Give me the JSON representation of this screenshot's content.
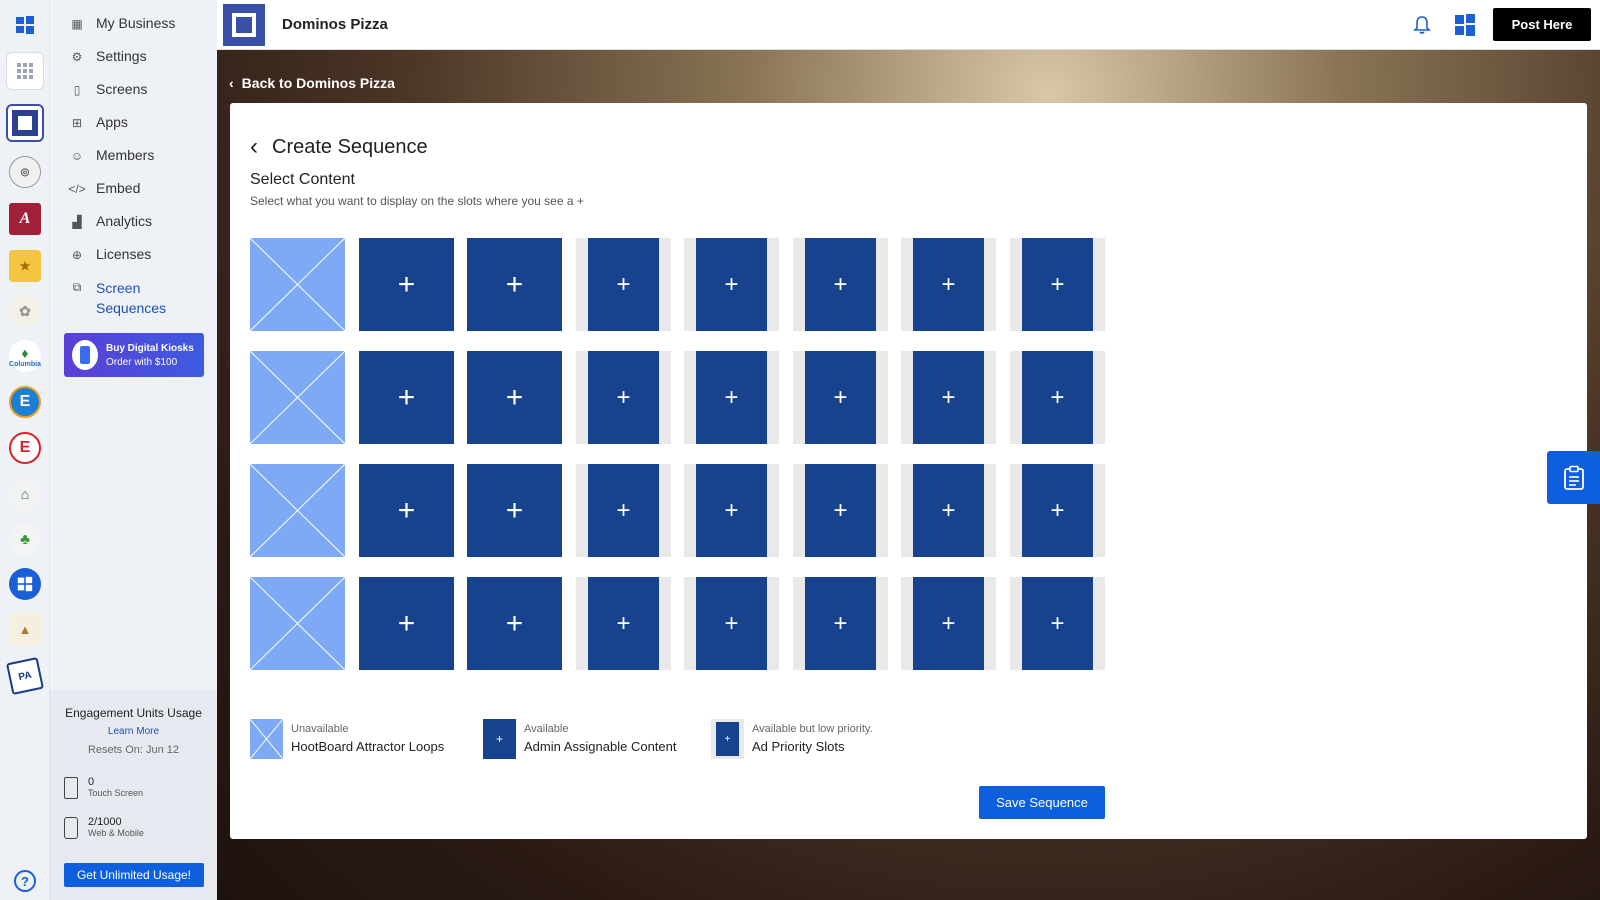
{
  "app": {
    "business_name": "Dominos Pizza",
    "post_button": "Post Here"
  },
  "rail": {
    "avatars": [
      {
        "icon": "community-seal-icon"
      },
      {
        "icon": "letter-a-icon",
        "text": "A"
      },
      {
        "icon": "badge-logo-icon"
      },
      {
        "icon": "crest-logo-icon"
      },
      {
        "icon": "columbia-logo-icon",
        "text": "Columbia"
      },
      {
        "icon": "letter-e-circle-icon",
        "text": "E"
      },
      {
        "icon": "letter-e-red-icon",
        "text": "E"
      },
      {
        "icon": "building-logo-icon"
      },
      {
        "icon": "plant-logo-icon"
      },
      {
        "icon": "hootboard-logo-icon"
      },
      {
        "icon": "library-logo-icon"
      },
      {
        "icon": "pa-flag-icon",
        "text": "PA"
      }
    ],
    "help": "?"
  },
  "sidebar": {
    "items": [
      {
        "label": "My Business",
        "icon": "grid-icon"
      },
      {
        "label": "Settings",
        "icon": "gear-icon"
      },
      {
        "label": "Screens",
        "icon": "kiosk-icon"
      },
      {
        "label": "Apps",
        "icon": "apps-icon"
      },
      {
        "label": "Members",
        "icon": "user-icon"
      },
      {
        "label": "Embed",
        "icon": "code-icon"
      },
      {
        "label": "Analytics",
        "icon": "chart-icon"
      },
      {
        "label": "Licenses",
        "icon": "upload-circle-icon"
      },
      {
        "label": "Screen Sequences",
        "icon": "sequence-icon",
        "active": true
      }
    ],
    "promo": {
      "title": "Buy Digital Kiosks",
      "subtitle": "Order with $100"
    },
    "usage": {
      "title": "Engagement Units Usage",
      "learn_more": "Learn More",
      "resets": "Resets On: Jun 12",
      "touch": {
        "value": "0",
        "label": "Touch Screen"
      },
      "web": {
        "value": "2/1000",
        "label": "Web & Mobile"
      },
      "cta": "Get Unlimited Usage!"
    }
  },
  "main": {
    "back_link": "Back to Dominos Pizza",
    "title": "Create Sequence",
    "section_title": "Select Content",
    "section_subtitle": "Select what you want to display on the slots where you see a +",
    "grid": {
      "rows": 4,
      "columns": [
        "unavailable",
        "available",
        "available",
        "low",
        "low",
        "low",
        "low",
        "low"
      ],
      "plus": "+"
    },
    "legend": [
      {
        "kind": "unavailable",
        "line1": "Unavailable",
        "line2": "HootBoard Attractor Loops"
      },
      {
        "kind": "available",
        "line1": "Available",
        "line2": "Admin Assignable Content"
      },
      {
        "kind": "low",
        "line1": "Available but low priority.",
        "line2": "Ad Priority Slots"
      }
    ],
    "save_button": "Save Sequence"
  },
  "colors": {
    "accent": "#0d5fe0",
    "slot_available": "#17438e",
    "slot_unavailable": "#7ea9f4",
    "slot_low_bg": "#e9e9e9"
  }
}
